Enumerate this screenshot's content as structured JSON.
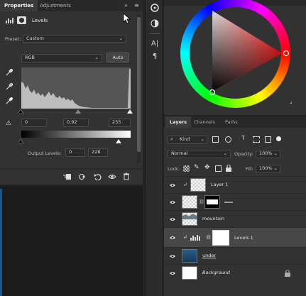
{
  "properties": {
    "tabs": [
      {
        "label": "Properties"
      },
      {
        "label": "Adjustments"
      }
    ],
    "panel_title": "Levels",
    "preset_label": "Preset:",
    "preset_value": "Custom",
    "channel_value": "RGB",
    "auto_label": "Auto",
    "input_black": "0",
    "input_gamma": "0,92",
    "input_white": "255",
    "output_label": "Output Levels:",
    "output_black": "0",
    "output_white": "228"
  },
  "layers": {
    "tabs": [
      {
        "label": "Layers"
      },
      {
        "label": "Channels"
      },
      {
        "label": "Paths"
      }
    ],
    "filter_kind": "Kind",
    "blend_mode": "Normal",
    "opacity_label": "Opacity:",
    "opacity_value": "100%",
    "lock_label": "Lock:",
    "fill_label": "Fill:",
    "fill_value": "100%",
    "items": [
      {
        "name": "Layer 1",
        "clipped": true,
        "selected": false,
        "has_mask": false,
        "thumb": "checker"
      },
      {
        "name": "",
        "clipped": false,
        "selected": false,
        "has_mask": true,
        "thumb": "checker"
      },
      {
        "name": "mountain",
        "clipped": false,
        "selected": false,
        "has_mask": false,
        "thumb": "mountain"
      },
      {
        "name": "Levels 1",
        "clipped": true,
        "selected": true,
        "has_mask": true,
        "thumb": "levels"
      },
      {
        "name": "under",
        "clipped": false,
        "selected": false,
        "has_mask": false,
        "thumb": "water"
      },
      {
        "name": "Background",
        "clipped": false,
        "selected": false,
        "has_mask": false,
        "thumb": "white",
        "locked": true
      }
    ]
  },
  "colors": {
    "panel_bg": "#323232",
    "selected_row": "#474747",
    "accent_red": "#ff2a2a"
  }
}
